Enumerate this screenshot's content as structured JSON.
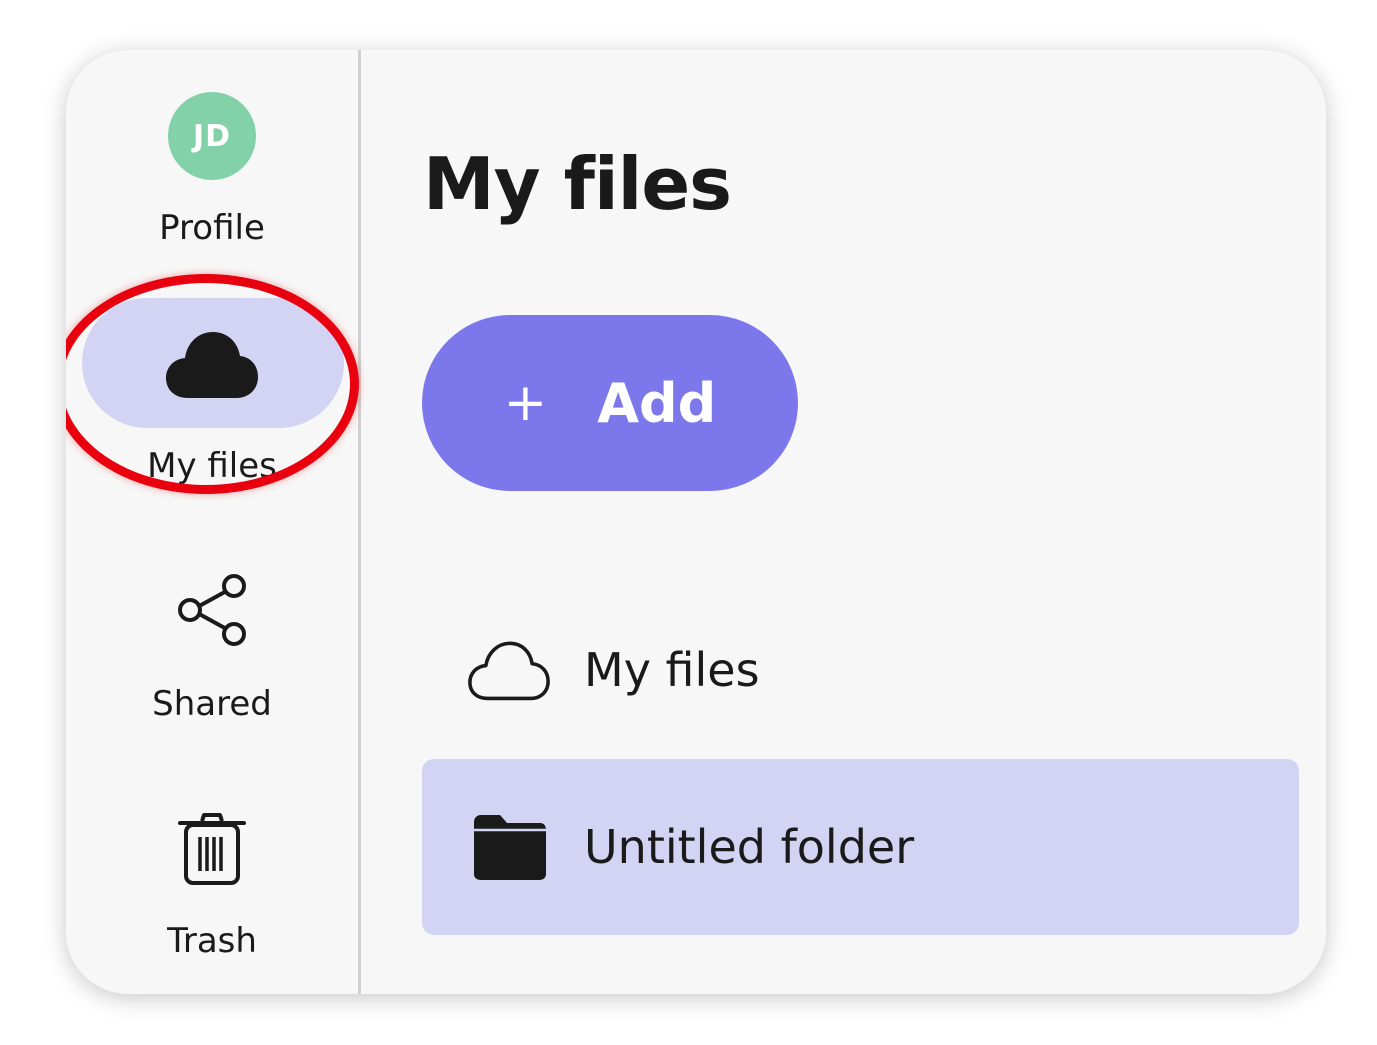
{
  "sidebar": {
    "profile": {
      "initials": "JD",
      "label": "Profile",
      "avatar_color": "#82d1a8"
    },
    "items": [
      {
        "id": "my-files",
        "label": "My files",
        "icon": "cloud-filled-icon",
        "active": true
      },
      {
        "id": "shared",
        "label": "Shared",
        "icon": "share-icon",
        "active": false
      },
      {
        "id": "trash",
        "label": "Trash",
        "icon": "trash-icon",
        "active": false
      }
    ],
    "active_color": "#d3d3f4"
  },
  "main": {
    "title": "My files",
    "add_button": {
      "icon": "plus-icon",
      "plus": "+",
      "label": "Add",
      "color": "#7c77ea"
    },
    "list": [
      {
        "label": "My files",
        "icon": "cloud-outline-icon",
        "selected": false
      },
      {
        "label": "Untitled folder",
        "icon": "folder-icon",
        "selected": true
      }
    ]
  },
  "annotation": {
    "shape": "circle",
    "color": "#e8000f",
    "target": "My files"
  }
}
